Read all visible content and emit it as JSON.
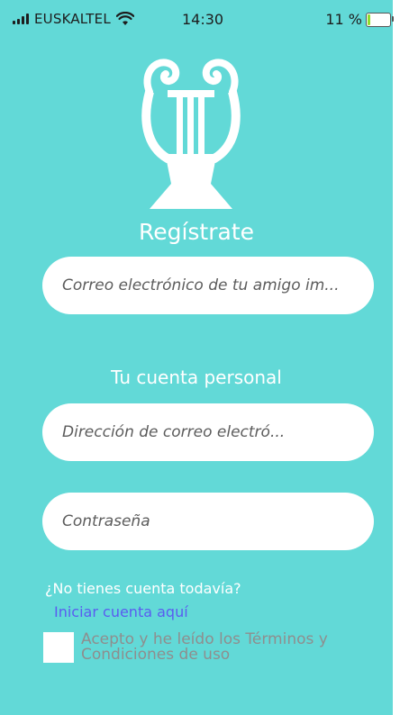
{
  "status_bar": {
    "carrier": "EUSKALTEL",
    "time": "14:30",
    "battery": "11 %",
    "battery_level": 0.11
  },
  "screen": {
    "title": "Regístrate",
    "friend_email": {
      "placeholder": "Correo electrónico de tu amigo im..."
    },
    "personal_heading": "Tu cuenta personal",
    "email": {
      "placeholder": "Dirección de correo electró..."
    },
    "password": {
      "placeholder": "Contraseña"
    },
    "no_account": "¿No tienes cuenta todavía?",
    "start_link": "Iniciar cuenta aquí",
    "terms": "Acepto y he leído los Términos y Condiciones de uso",
    "terms_checked": false
  },
  "colors": {
    "background": "#62d9d7",
    "link": "#5a5cf0",
    "battery": "#8fdd2a"
  }
}
